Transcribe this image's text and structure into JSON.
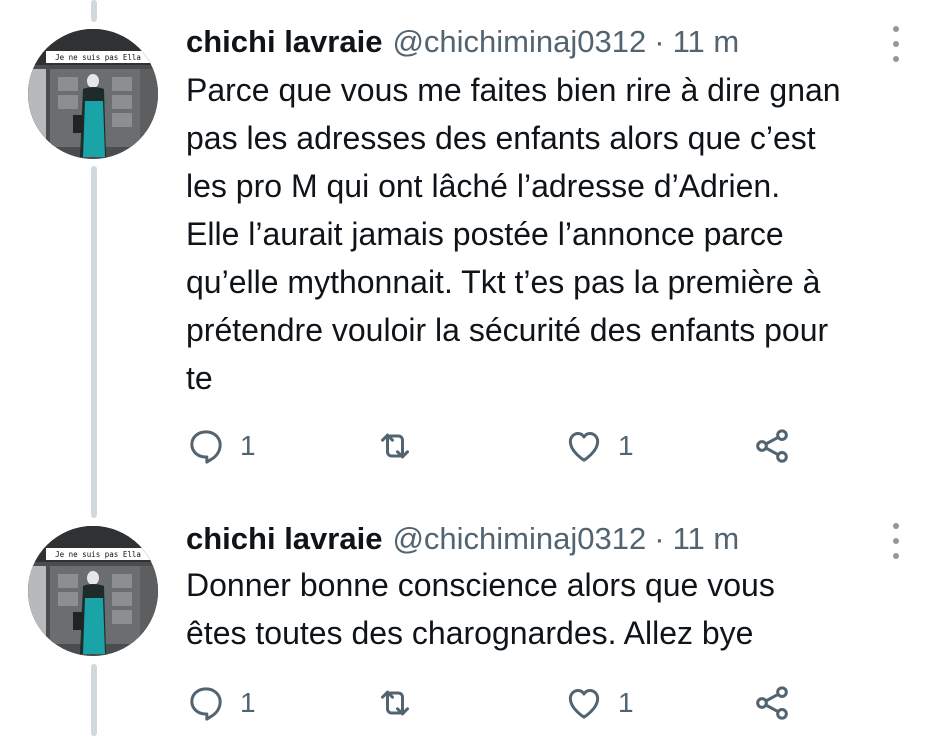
{
  "tweets": [
    {
      "author_name": "chichi lavraie",
      "handle": "@chichiminaj0312",
      "separator": "·",
      "time": "11 m",
      "avatar_caption": "Je ne suis pas Ella",
      "text": "Parce que vous me faites bien rire à dire gnan\npas les adresses des enfants alors que c’est\nles pro M qui ont lâché l’adresse d’Adrien.\nElle l’aurait jamais postée l’annonce parce\nqu’elle mythonnait. Tkt t’es pas la première à\nprétendre vouloir la sécurité des enfants pour\nte",
      "replies": "1",
      "likes": "1",
      "icons": [
        "reply-icon",
        "retweet-icon",
        "like-icon",
        "share-icon",
        "more-options-icon"
      ]
    },
    {
      "author_name": "chichi lavraie",
      "handle": "@chichiminaj0312",
      "separator": "·",
      "time": "11 m",
      "avatar_caption": "Je ne suis pas Ella",
      "text": "Donner bonne conscience alors que vous\nêtes toutes des charognardes. Allez bye",
      "replies": "1",
      "likes": "1",
      "icons": [
        "reply-icon",
        "retweet-icon",
        "like-icon",
        "share-icon",
        "more-options-icon"
      ]
    }
  ],
  "colors": {
    "text": "#0f1419",
    "secondary": "#536471",
    "thread_line": "#cfd9de",
    "more_dots": "#8b98a5"
  }
}
